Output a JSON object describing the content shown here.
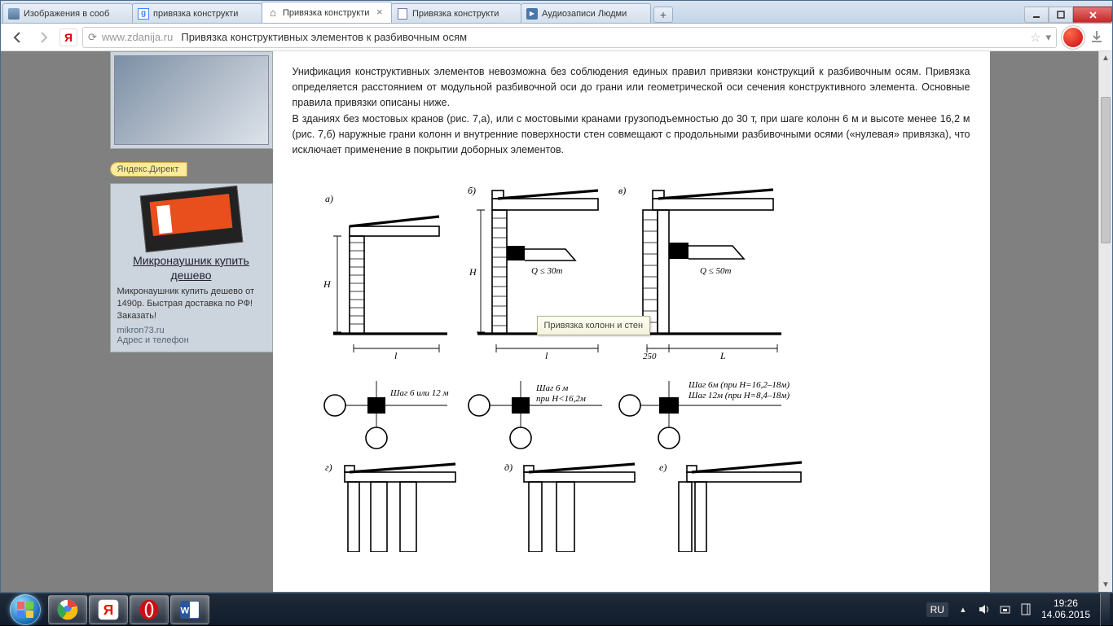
{
  "browser": {
    "tabs": [
      {
        "label": "Изображения в сооб",
        "type": "image"
      },
      {
        "label": "привязка конструкти",
        "type": "google"
      },
      {
        "label": "Привязка конструкти",
        "type": "home",
        "active": true
      },
      {
        "label": "Привязка конструкти",
        "type": "doc"
      },
      {
        "label": "Аудиозаписи Людми",
        "type": "vk"
      }
    ],
    "address": {
      "host": "www.zdanija.ru",
      "title": "Привязка конструктивных элементов к разбивочным осям"
    }
  },
  "page": {
    "direct_badge": "Яндекс.Директ",
    "ad": {
      "title": "Микронаушник купить дешево",
      "text": "Микронаушник купить дешево от 1490р. Быстрая доставка по РФ! Заказать!",
      "domain": "mikron73.ru",
      "addr": "Адрес и телефон"
    },
    "article": {
      "p1": "Унификация конструктивных элементов невозможна без соблюдения единых правил привязки конструкций к разбивочным осям. Привязка определяется расстоянием от модульной разбивочной оси до грани или геометрической оси сечения конструктивного элемента. Основные правила привязки описаны ниже.",
      "p2": "В зданиях без мостовых кранов (рис. 7,а), или с мостовыми кранами грузоподъемностью до 30 т, при шаге колонн 6 м и высоте менее 16,2 м (рис. 7,б) наружные грани колонн и внутренние поверхности стен совмещают с продольными разбивочными осями («нулевая» привязка), что исключает применение в покрытии доборных элементов."
    },
    "tooltip": "Привязка колонн и стен",
    "figure": {
      "labels": {
        "a": "а)",
        "b": "б)",
        "v": "в)",
        "g": "г)",
        "d": "д)",
        "e": "е)"
      },
      "dims": {
        "H": "H",
        "l": "l",
        "L": "L",
        "q30": "Q ≤ 30т",
        "q50": "Q ≤ 50т",
        "d250": "250",
        "step_a": "Шаг 6 или 12 м",
        "step_b1": "Шаг 6 м",
        "step_b2": "при H<16,2м",
        "step_v1": "Шаг 6м (при H=16,2–18м)",
        "step_v2": "Шаг 12м (при H=8,4–18м)"
      }
    }
  },
  "taskbar": {
    "lang": "RU",
    "time": "19:26",
    "date": "14.06.2015"
  }
}
